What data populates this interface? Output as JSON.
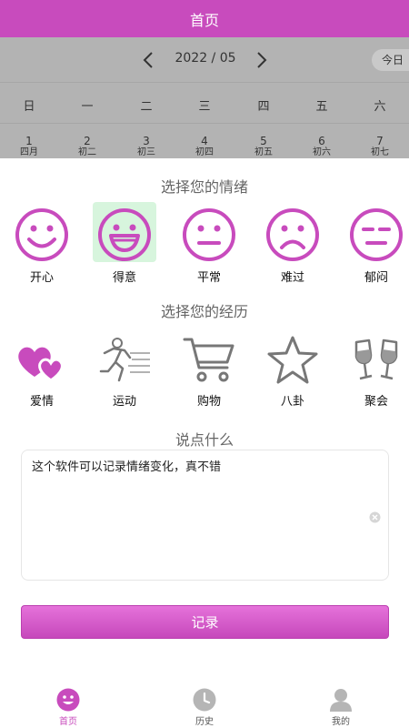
{
  "header": {
    "title": "首页"
  },
  "calendar": {
    "month": "2022 / 05",
    "today_label": "今日",
    "weekdays": [
      "日",
      "一",
      "二",
      "三",
      "四",
      "五",
      "六"
    ],
    "days": [
      {
        "n": "1",
        "l": "四月"
      },
      {
        "n": "2",
        "l": "初二"
      },
      {
        "n": "3",
        "l": "初三"
      },
      {
        "n": "4",
        "l": "初四"
      },
      {
        "n": "5",
        "l": "初五"
      },
      {
        "n": "6",
        "l": "初六"
      },
      {
        "n": "7",
        "l": "初七"
      }
    ]
  },
  "mood": {
    "title": "选择您的情绪",
    "items": [
      {
        "label": "开心",
        "icon": "happy-face-icon"
      },
      {
        "label": "得意",
        "icon": "grin-face-icon",
        "selected": true
      },
      {
        "label": "平常",
        "icon": "neutral-face-icon"
      },
      {
        "label": "难过",
        "icon": "sad-face-icon"
      },
      {
        "label": "郁闷",
        "icon": "depressed-face-icon"
      }
    ]
  },
  "experience": {
    "title": "选择您的经历",
    "items": [
      {
        "label": "爱情",
        "icon": "hearts-icon"
      },
      {
        "label": "运动",
        "icon": "runner-icon"
      },
      {
        "label": "购物",
        "icon": "cart-icon"
      },
      {
        "label": "八卦",
        "icon": "star-icon"
      },
      {
        "label": "聚会",
        "icon": "champagne-icon"
      }
    ]
  },
  "note": {
    "title": "说点什么",
    "value": "这个软件可以记录情绪变化，真不错"
  },
  "record_button": "记录",
  "tabs": [
    {
      "label": "首页",
      "icon": "smile-icon",
      "active": true
    },
    {
      "label": "历史",
      "icon": "clock-icon"
    },
    {
      "label": "我的",
      "icon": "user-icon"
    }
  ],
  "colors": {
    "accent": "#c84bbd",
    "selected_bg": "#d7f5dd",
    "overlay": "#b3b3b3"
  }
}
